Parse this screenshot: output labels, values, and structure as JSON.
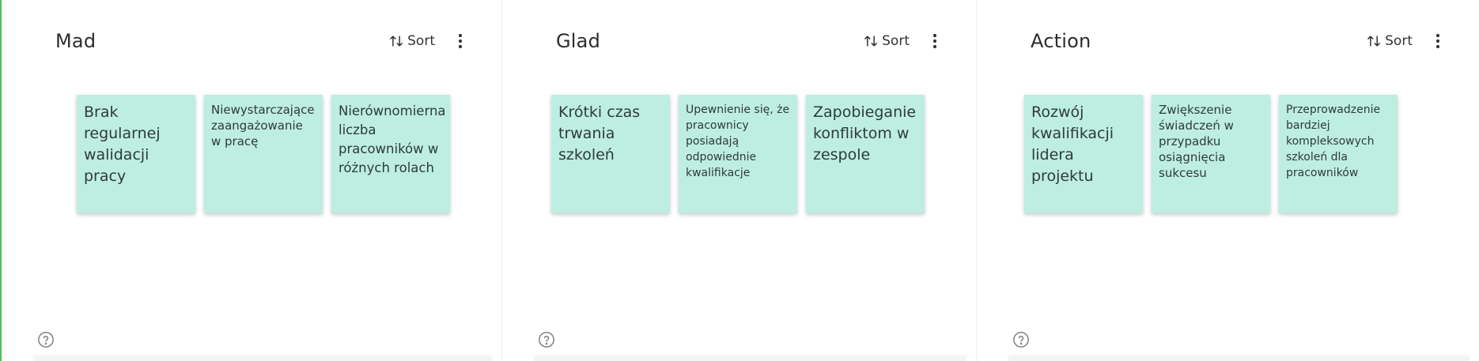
{
  "sort_label": "Sort",
  "icons": {
    "sort": "sort-arrows-icon",
    "more": "more-vertical-icon",
    "help": "help-circle-icon"
  },
  "colors": {
    "note_background": "#bdeee1",
    "accent": "#4cc35a"
  },
  "columns": [
    {
      "title": "Mad",
      "notes": [
        "Brak regularnej walidacji pracy",
        "Niewystarczające zaangażowanie w pracę",
        "Nierównomierna liczba pracowników w różnych rolach"
      ]
    },
    {
      "title": "Glad",
      "notes": [
        "Krótki czas trwania szkoleń",
        "Upewnienie się, że pracownicy posiadają odpowiednie kwalifikacje",
        "Zapobieganie konfliktom w zespole"
      ]
    },
    {
      "title": "Action",
      "notes": [
        "Rozwój kwalifikacji lidera projektu",
        "Zwiększenie świadczeń w przypadku osiągnięcia sukcesu",
        "Przeprowadzenie bardziej kompleksowych szkoleń dla pracowników"
      ]
    }
  ]
}
